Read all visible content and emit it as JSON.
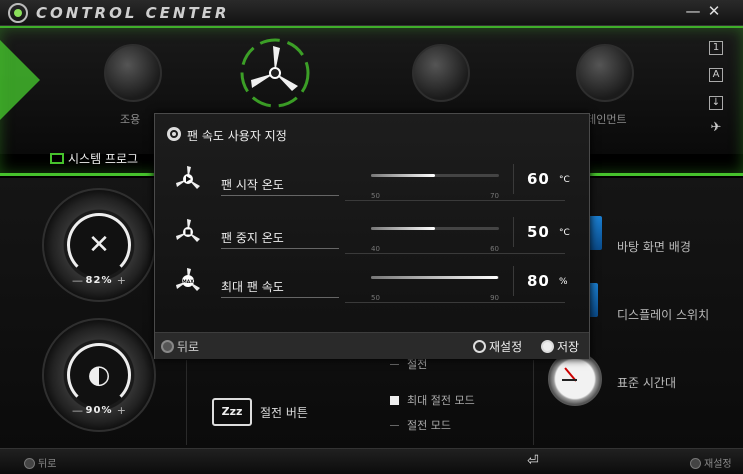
{
  "window": {
    "title": "CONTROL CENTER",
    "minimize": "—",
    "close": "✕"
  },
  "ribbon": {
    "items": [
      {
        "label": "조용",
        "icon": "speaker-icon"
      },
      {
        "label": "",
        "icon": "fan-icon"
      },
      {
        "label": "",
        "icon": "gauge-icon"
      },
      {
        "label": "터테인먼트",
        "icon": "crosshair-icon"
      }
    ],
    "side_buttons": [
      "1",
      "A",
      "↓",
      "✈"
    ]
  },
  "system_tab": {
    "label": "시스템 프로그"
  },
  "gauges": [
    {
      "symbol": "✕",
      "value": "82%",
      "minus": "—",
      "plus": "+"
    },
    {
      "symbol": "◐",
      "value": "90%",
      "minus": "—",
      "plus": "+"
    }
  ],
  "right_panel": {
    "items": [
      "바탕 화면 배경",
      "디스플레이 스위치",
      "표준 시간대"
    ]
  },
  "sleep": {
    "button_text": "Zzz",
    "label": "절전 버튼",
    "options": [
      "절전",
      "최대 절전 모드",
      "절전 모드"
    ]
  },
  "bottombar": {
    "back": "뒤로",
    "reset": "재설정"
  },
  "dialog": {
    "title": "팬 속도 사용자 지정",
    "rows": [
      {
        "label": "팬 시작 온도",
        "value": "60",
        "unit": "°C",
        "min": "50",
        "max": "70",
        "level": 0.5
      },
      {
        "label": "팬 중지 온도",
        "value": "50",
        "unit": "°C",
        "min": "40",
        "max": "60",
        "level": 0.5
      },
      {
        "label": "최대 팬 속도",
        "value": "80",
        "unit": "%",
        "min": "50",
        "max": "90",
        "level": 0.99
      }
    ],
    "footer": {
      "back": "뒤로",
      "reset": "재설정",
      "save": "저장"
    }
  }
}
